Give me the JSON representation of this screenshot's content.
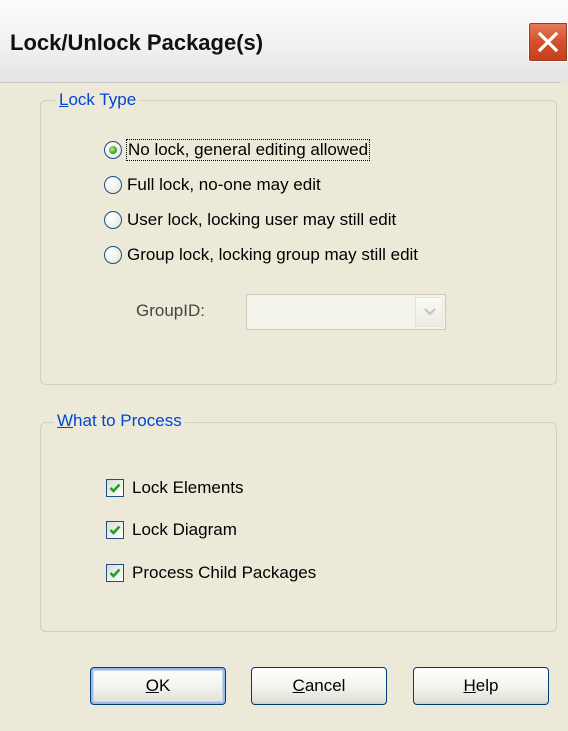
{
  "window": {
    "title": "Lock/Unlock Package(s)",
    "close_icon": "close-icon"
  },
  "lock_type": {
    "legend_mnemonic": "L",
    "legend_rest": "ock Type",
    "options": [
      {
        "label": "No lock, general editing allowed",
        "selected": true
      },
      {
        "label": "Full lock, no-one may edit",
        "selected": false
      },
      {
        "label": "User lock, locking user may still edit",
        "selected": false
      },
      {
        "label": "Group lock, locking group may still edit",
        "selected": false
      }
    ],
    "groupid_label": "GroupID:",
    "groupid_value": "",
    "groupid_enabled": false
  },
  "what_to_process": {
    "legend_mnemonic": "W",
    "legend_rest": "hat to Process",
    "options": [
      {
        "label": "Lock Elements",
        "checked": true
      },
      {
        "label": "Lock Diagram",
        "checked": true
      },
      {
        "label": "Process Child Packages",
        "checked": true
      }
    ]
  },
  "buttons": {
    "ok_mnemonic": "O",
    "ok_rest": "K",
    "cancel_mnemonic": "C",
    "cancel_rest": "ancel",
    "help_mnemonic": "H",
    "help_rest": "elp"
  },
  "colors": {
    "legend_text": "#0046d5",
    "dialog_bg": "#ece9d8",
    "close_button": "#d4502b",
    "check_mark": "#21a121"
  }
}
